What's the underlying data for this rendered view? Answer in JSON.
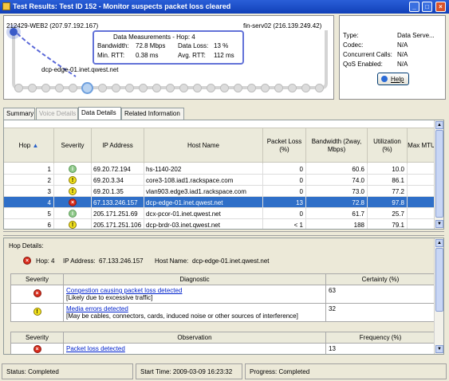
{
  "window": {
    "title": "Test Results: Test ID 152 - Monitor suspects packet loss cleared",
    "min": "_",
    "max": "□",
    "close": "×"
  },
  "path": {
    "left_host": "212429-WEB2 (207.97.192.167)",
    "right_host": "fin-serv02 (216.139.249.42)",
    "hop_label": "dcp-edge-01.inet.qwest.net",
    "measure": {
      "title": "Data Measurements - Hop: 4",
      "bandwidth_label": "Bandwidth:",
      "bandwidth_value": "72.8 Mbps",
      "loss_label": "Data Loss:",
      "loss_value": "13 %",
      "minrtt_label": "Min. RTT:",
      "minrtt_value": "0.38 ms",
      "avgrtt_label": "Avg. RTT:",
      "avgrtt_value": "112 ms"
    }
  },
  "info": {
    "type_label": "Type:",
    "type_value": "Data Serve...",
    "codec_label": "Codec:",
    "codec_value": "N/A",
    "calls_label": "Concurrent Calls:",
    "calls_value": "N/A",
    "qos_label": "QoS Enabled:",
    "qos_value": "N/A",
    "help": "Help"
  },
  "tabs": [
    "Summary",
    "Voice Details",
    "Data Details",
    "Related Information"
  ],
  "grid": {
    "columns": [
      "Hop",
      "Severity",
      "IP Address",
      "Host Name",
      "Packet Loss (%)",
      "Bandwidth (2way, Mbps)",
      "Utilization (%)",
      "Max MTU"
    ],
    "sort_arrow": "▲",
    "rows": [
      {
        "hop": "1",
        "sev": "info",
        "ip": "69.20.72.194",
        "host": "hs-1140-202",
        "loss": "0",
        "bw": "60.6",
        "util": "10.0"
      },
      {
        "hop": "2",
        "sev": "warn",
        "ip": "69.20.3.34",
        "host": "core3-108.iad1.rackspace.com",
        "loss": "0",
        "bw": "74.0",
        "util": "86.1"
      },
      {
        "hop": "3",
        "sev": "warn",
        "ip": "69.20.1.35",
        "host": "vlan903.edge3.iad1.rackspace.com",
        "loss": "0",
        "bw": "73.0",
        "util": "77.2"
      },
      {
        "hop": "4",
        "sev": "err",
        "ip": "67.133.246.157",
        "host": "dcp-edge-01.inet.qwest.net",
        "loss": "13",
        "bw": "72.8",
        "util": "97.8"
      },
      {
        "hop": "5",
        "sev": "info",
        "ip": "205.171.251.69",
        "host": "dcx-pcor-01.inet.qwest.net",
        "loss": "0",
        "bw": "61.7",
        "util": "25.7"
      },
      {
        "hop": "6",
        "sev": "warn",
        "ip": "205.171.251.106",
        "host": "dcp-brdr-03.inet.qwest.net",
        "loss": "< 1",
        "bw": "188",
        "util": "79.1"
      }
    ]
  },
  "hop": {
    "section": "Hop Details:",
    "hop_label": "Hop:",
    "hop_value": "4",
    "ip_label": "IP Address:",
    "ip_value": "67.133.246.157",
    "host_label": "Host Name:",
    "host_value": "dcp-edge-01.inet.qwest.net",
    "diag_cols": [
      "Severity",
      "Diagnostic",
      "Certainty (%)"
    ],
    "diags": [
      {
        "sev": "err",
        "link": "Congestion causing packet loss detected",
        "note": "[Likely due to excessive traffic]",
        "certainty": "63"
      },
      {
        "sev": "warn",
        "link": "Media errors detected",
        "note": "[May be cables, connectors, cards, induced noise or other sources of interference]",
        "certainty": "32"
      }
    ],
    "obs_cols": [
      "Severity",
      "Observation",
      "Frequency (%)"
    ],
    "obs": [
      {
        "sev": "err",
        "link": "Packet loss detected",
        "freq": "13"
      }
    ]
  },
  "status": {
    "status": "Status: Completed",
    "start": "Start Time:  2009-03-09 16:23:32",
    "progress": "Progress:   Completed"
  }
}
